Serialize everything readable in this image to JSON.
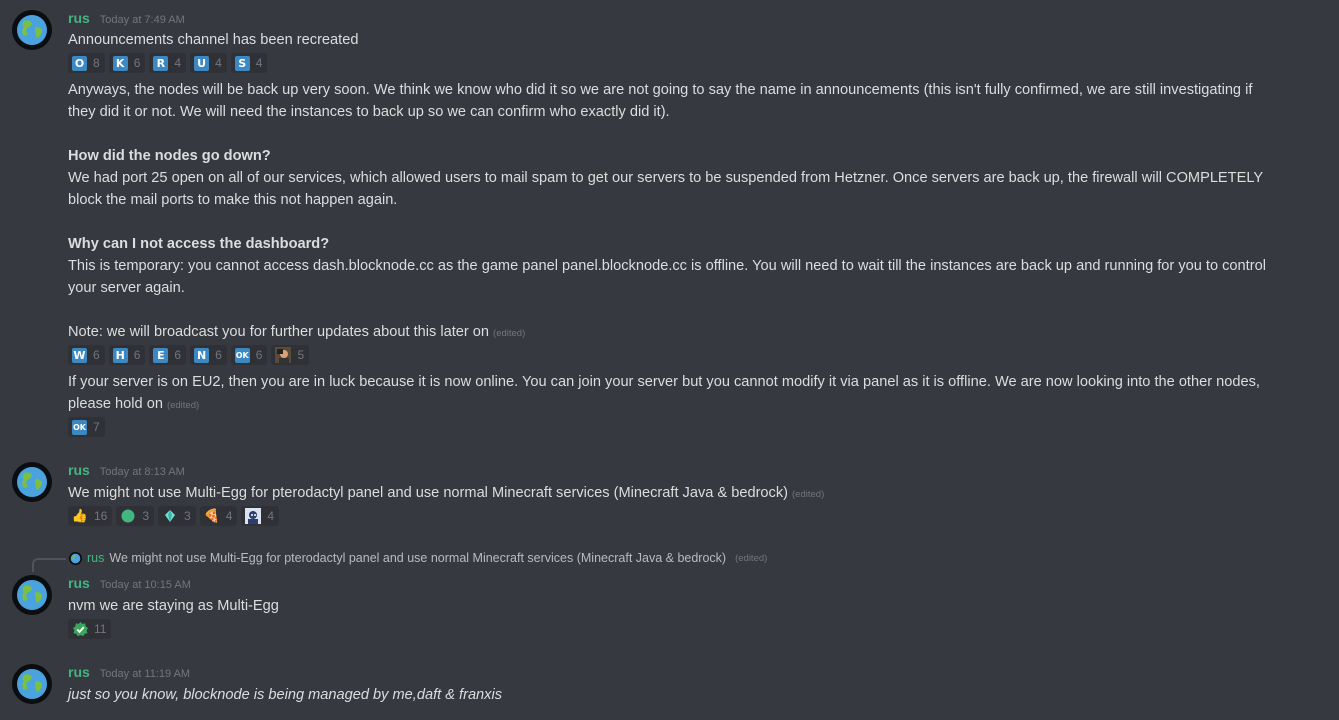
{
  "colors": {
    "background": "#36393f",
    "username": "#43b581",
    "timestamp": "#72767d",
    "reaction_bg": "#2f3136",
    "letter_badge": "#3b88c3"
  },
  "messages": [
    {
      "username": "rus",
      "timestamp": "Today at 7:49 AM",
      "line1": "Announcements channel has been recreated",
      "reactions1": [
        {
          "label": "O",
          "count": "8"
        },
        {
          "label": "K",
          "count": "6"
        },
        {
          "label": "R",
          "count": "4"
        },
        {
          "label": "U",
          "count": "4"
        },
        {
          "label": "S",
          "count": "4"
        }
      ],
      "p1_l1": "Anyways, the nodes will be back up very soon. We think we know who did it so we are not going to say the name in announcements (this isn't fully confirmed, we are still investigating if",
      "p1_l2": "they did it or not. We will need the instances to back up so we can confirm who exactly did it).",
      "h1": "How did the nodes go down?",
      "p2_l1": "We had port 25 open on all of our services, which allowed users to mail spam to get our servers to be suspended from Hetzner. Once servers are back up, the firewall will COMPLETELY",
      "p2_l2": "block the mail ports to make this not happen again.",
      "h2": "Why can I not access the dashboard?",
      "p3_l1": "This is temporary: you cannot access dash.blocknode.cc as the game panel panel.blocknode.cc is offline. You will need to wait till the instances are back up and running for you to control",
      "p3_l2": "your server again.",
      "note": "Note: we will broadcast you for further updates about this later on",
      "edited": "(edited)",
      "reactions2": [
        {
          "label": "W",
          "count": "6"
        },
        {
          "label": "H",
          "count": "6"
        },
        {
          "label": "E",
          "count": "6"
        },
        {
          "label": "N",
          "count": "6"
        },
        {
          "label": "OK",
          "count": "6"
        },
        {
          "icon": "avatar-emoji",
          "count": "5"
        }
      ],
      "p4_l1": "If your server is on EU2, then you are in luck because it is now online. You can join your server but you cannot modify it via panel as it is offline. We are now looking into the other nodes,",
      "p4_l2": "please hold on",
      "reactions3": [
        {
          "label": "OK",
          "count": "7"
        }
      ]
    },
    {
      "username": "rus",
      "timestamp": "Today at 8:13 AM",
      "text": "We might not use Multi-Egg for pterodactyl panel and use normal Minecraft services (Minecraft Java & bedrock)",
      "edited": "(edited)",
      "reactions": [
        {
          "icon": "thumbs-up-icon",
          "glyph": "👍",
          "count": "16"
        },
        {
          "icon": "green-circle-icon",
          "count": "3"
        },
        {
          "icon": "diamond-emoji-icon",
          "count": "3"
        },
        {
          "icon": "pizza-icon",
          "glyph": "🍕",
          "count": "4"
        },
        {
          "icon": "custom-avatar-emoji",
          "count": "4"
        }
      ]
    },
    {
      "reply_to": {
        "username": "rus",
        "text": "We might not use Multi-Egg for pterodactyl panel and use normal Minecraft services (Minecraft Java & bedrock)",
        "edited": "(edited)"
      },
      "username": "rus",
      "timestamp": "Today at 10:15 AM",
      "text": "nvm we are staying as Multi-Egg",
      "reactions": [
        {
          "icon": "check-mark-icon",
          "count": "11"
        }
      ]
    },
    {
      "username": "rus",
      "timestamp": "Today at 11:19 AM",
      "text": "just so you know, blocknode is being managed by me,daft & franxis"
    }
  ]
}
